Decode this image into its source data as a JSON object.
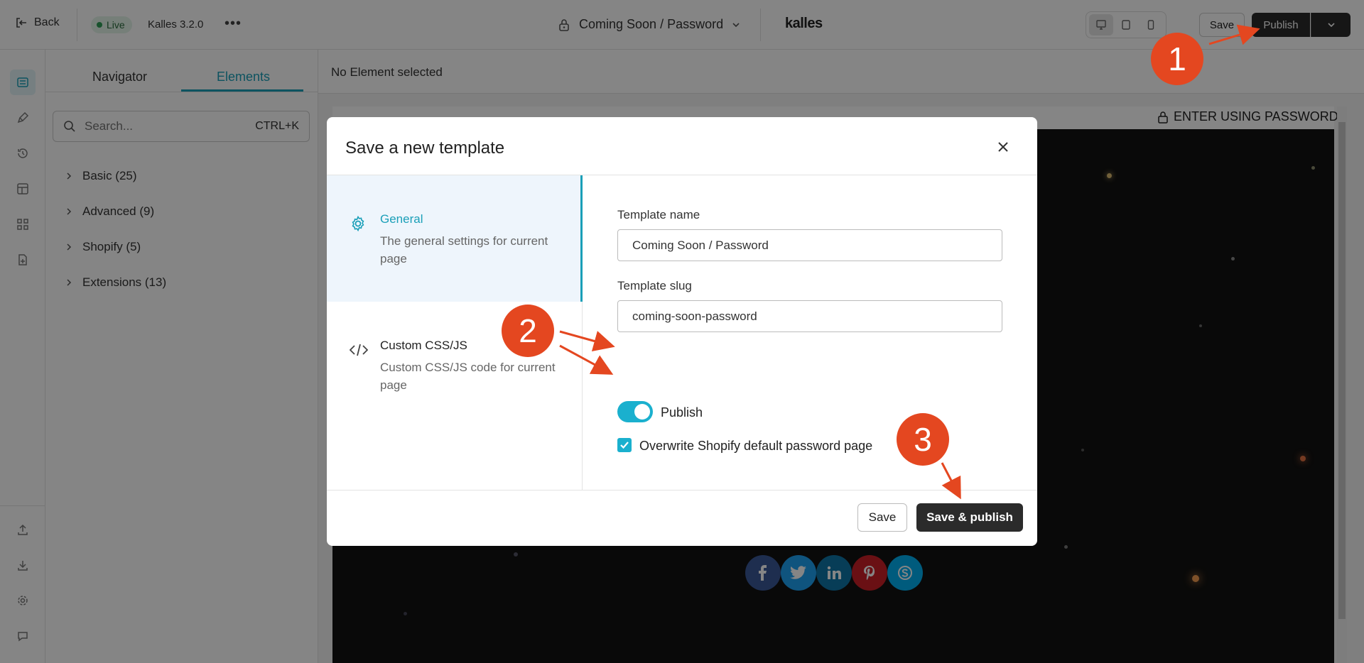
{
  "topbar": {
    "back_label": "Back",
    "live_label": "Live",
    "theme_version": "Kalles 3.2.0",
    "more_label": "•••",
    "page_selector": "Coming Soon / Password",
    "brand": "kalles",
    "save_label": "Save",
    "publish_label": "Publish"
  },
  "panel": {
    "tabs": [
      "Navigator",
      "Elements"
    ],
    "active_tab": "Elements",
    "search_placeholder": "Search...",
    "search_shortcut": "CTRL+K",
    "categories": [
      "Basic (25)",
      "Advanced (9)",
      "Shopify (5)",
      "Extensions (13)"
    ]
  },
  "canvas": {
    "status": "No Element selected",
    "enter_password_label": "ENTER USING PASSWORD"
  },
  "modal": {
    "title": "Save a new template",
    "nav": [
      {
        "title": "General",
        "desc": "The general settings for current page"
      },
      {
        "title": "Custom CSS/JS",
        "desc": "Custom CSS/JS code for current page"
      }
    ],
    "template_name_label": "Template name",
    "template_name_value": "Coming Soon / Password",
    "template_slug_label": "Template slug",
    "template_slug_value": "coming-soon-password",
    "publish_toggle_label": "Publish",
    "publish_on": true,
    "overwrite_label": "Overwrite Shopify default password page",
    "overwrite_checked": true,
    "save_label": "Save",
    "save_publish_label": "Save & publish"
  },
  "annotations": {
    "step1": "1",
    "step2": "2",
    "step3": "3"
  },
  "colors": {
    "accent": "#1a9fb8",
    "annotation": "#e44720",
    "dark_button": "#2b2b2b"
  }
}
